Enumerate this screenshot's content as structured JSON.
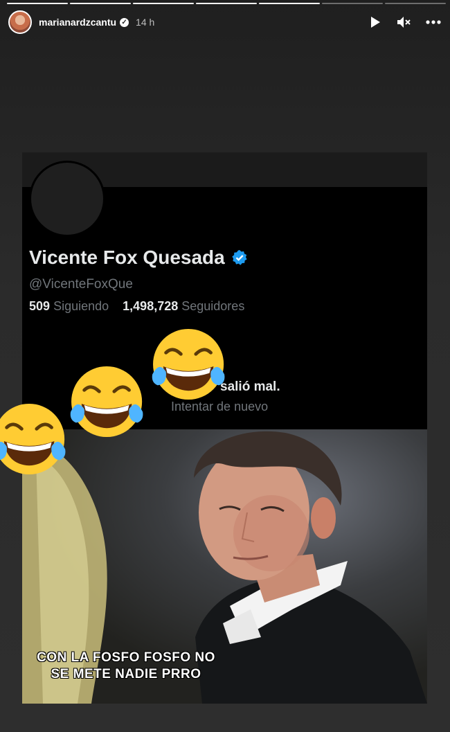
{
  "story": {
    "username": "marianardzcantu",
    "time": "14 h",
    "progress_total": 7,
    "progress_done": 5
  },
  "tweet_profile": {
    "display_name": "Vicente Fox Quesada",
    "handle": "@VicenteFoxQue",
    "following_count": "509",
    "following_label": "Siguiendo",
    "followers_count": "1,498,728",
    "followers_label": "Seguidores",
    "error_title": "salió mal.",
    "error_retry": "Intentar de nuevo"
  },
  "meme": {
    "caption_line1": "CON LA FOSFO FOSFO NO",
    "caption_line2": "SE METE NADIE PRRO"
  },
  "icons": [
    "play-icon",
    "mute-icon",
    "more-icon",
    "verified-icon",
    "blue-check-icon",
    "laughing-emoji"
  ],
  "colors": {
    "accent_blue": "#1d9bf0",
    "emoji_yellow": "#ffcc33"
  }
}
